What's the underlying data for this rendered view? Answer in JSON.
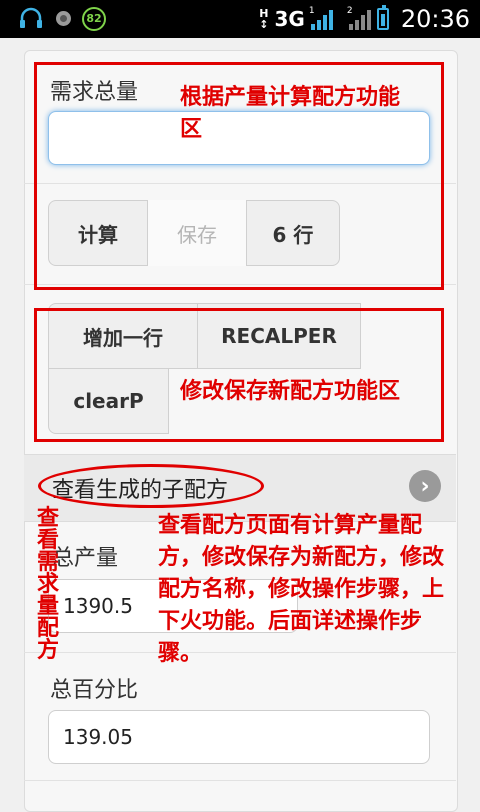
{
  "status_bar": {
    "battery_level": "82",
    "network_h": "H",
    "network_3g": "3G",
    "signal1_index": "1",
    "signal2_index": "2",
    "time": "20:36"
  },
  "form": {
    "demand_total_label": "需求总量",
    "demand_total_value": "",
    "buttons": {
      "calculate": "计算",
      "save": "保存",
      "rows": "6 行",
      "add_row": "增加一行",
      "recalper": "RECALPER",
      "clearp": "clearP"
    },
    "collapsible_title": "查看生成的子配方",
    "total_output_label": "总产量",
    "total_output_value": "1390.5",
    "total_percent_label": "总百分比",
    "total_percent_value": "139.05"
  },
  "annotations": {
    "calc_area": "根据产量计算配方功能区",
    "modify_area": "修改保存新配方功能区",
    "view_demand": "查看需求量配方",
    "view_desc": "查看配方页面有计算产量配方，修改保存为新配方，修改配方名称，修改操作步骤，上下火功能。后面详述操作步骤。"
  },
  "colors": {
    "annotation": "#e00000",
    "focus": "#7ab6ea",
    "signal": "#3fb3e5",
    "battery_circle": "#7fd34a"
  }
}
